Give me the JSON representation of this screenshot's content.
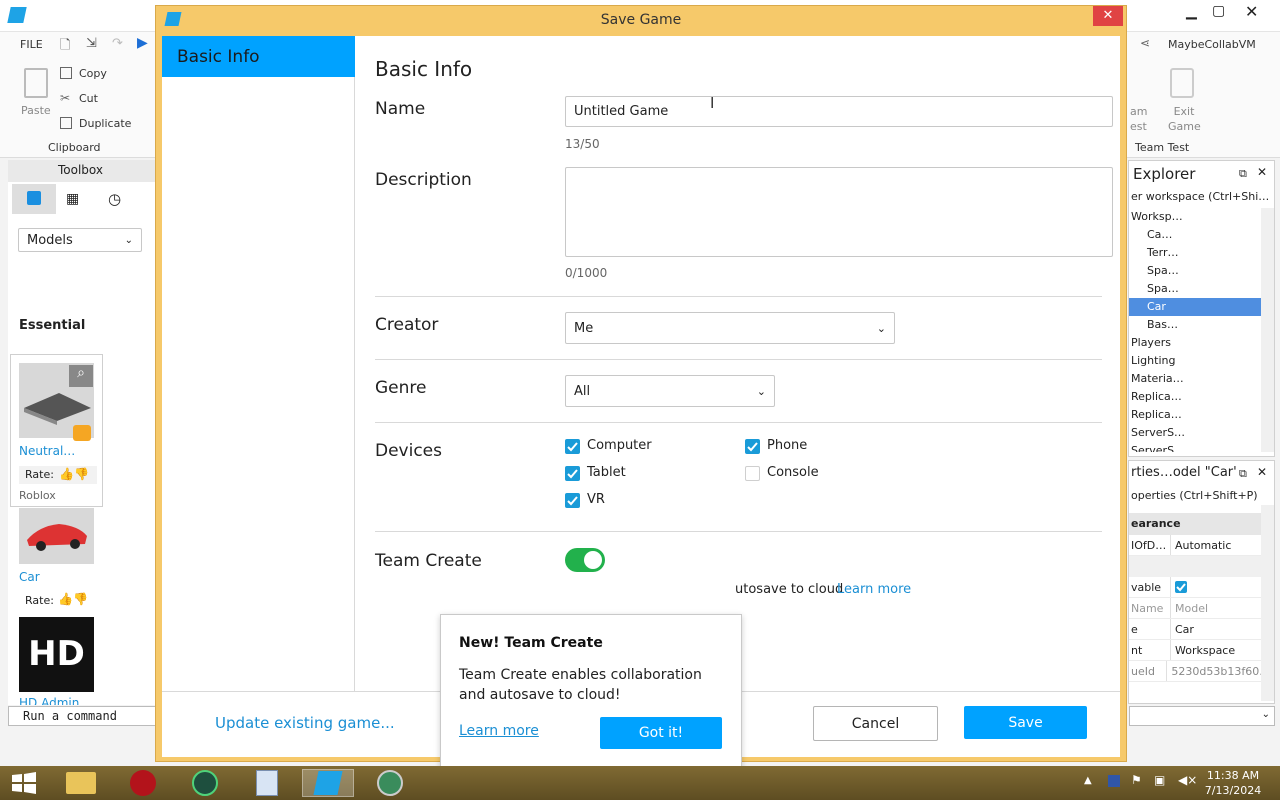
{
  "studio": {
    "ribbon": {
      "file_label": "FILE",
      "paste": "Paste",
      "copy": "Copy",
      "cut": "Cut",
      "duplicate": "Duplicate",
      "clipboard": "Clipboard",
      "user": "MaybeCollabVM",
      "team_test_partial": "am\nest",
      "exit_game": "Exit Game",
      "team_test": "Team Test"
    },
    "toolbox": {
      "title": "Toolbox",
      "category": "Models",
      "section": "Essential",
      "items": [
        {
          "name": "Neutral…",
          "rate": "Rate:",
          "creator": "Roblox"
        },
        {
          "name": "Car",
          "rate": "Rate:"
        },
        {
          "name": "HD Admin",
          "thumb_text": "HD"
        }
      ]
    },
    "command_bar": "Run a command",
    "explorer": {
      "title": "Explorer",
      "filter": "er workspace (Ctrl+Shi…",
      "rows": [
        "Worksp…",
        "Ca…",
        "Terr…",
        "Spa…",
        "Spa…",
        "Car",
        "Bas…",
        "Players",
        "Lighting",
        "Materia…",
        "Replica…",
        "Replica…",
        "ServerS…",
        "ServerS…"
      ]
    },
    "properties": {
      "title": "rties…odel \"Car\"",
      "filter": "operties (Ctrl+Shift+P)",
      "section": "earance",
      "rows": [
        {
          "k": "IOfD…",
          "v": "Automatic"
        },
        {
          "k": "vable",
          "v": "checked"
        },
        {
          "k": "Name",
          "v": "Model"
        },
        {
          "k": "e",
          "v": "Car"
        },
        {
          "k": "nt",
          "v": "Workspace"
        },
        {
          "k": "ueId",
          "v": "5230d53b13f60…"
        }
      ]
    }
  },
  "dialog": {
    "title": "Save Game",
    "nav": [
      "Basic Info"
    ],
    "heading": "Basic Info",
    "name_label": "Name",
    "name_value": "Untitled Game",
    "name_count": "13/50",
    "description_label": "Description",
    "description_value": "",
    "description_count": "0/1000",
    "creator_label": "Creator",
    "creator_value": "Me",
    "genre_label": "Genre",
    "genre_value": "All",
    "devices_label": "Devices",
    "devices": [
      {
        "label": "Computer",
        "checked": true
      },
      {
        "label": "Phone",
        "checked": true
      },
      {
        "label": "Tablet",
        "checked": true
      },
      {
        "label": "Console",
        "checked": false
      },
      {
        "label": "VR",
        "checked": true
      }
    ],
    "team_create_label": "Team Create",
    "team_create_on": true,
    "team_create_desc_partial": "utosave to cloud",
    "learn_more": "Learn more",
    "update_existing": "Update existing game...",
    "cancel": "Cancel",
    "save": "Save"
  },
  "popover": {
    "title": "New! Team Create",
    "body": "Team Create enables collaboration and autosave to cloud!",
    "learn_more": "Learn more",
    "got_it": "Got it!"
  },
  "taskbar": {
    "time": "11:38 AM",
    "date": "7/13/2024"
  },
  "colors": {
    "accent": "#00a2ff",
    "dialog_frame": "#f6c96a",
    "toggle_on": "#22b14c",
    "link": "#1b8fd4"
  }
}
